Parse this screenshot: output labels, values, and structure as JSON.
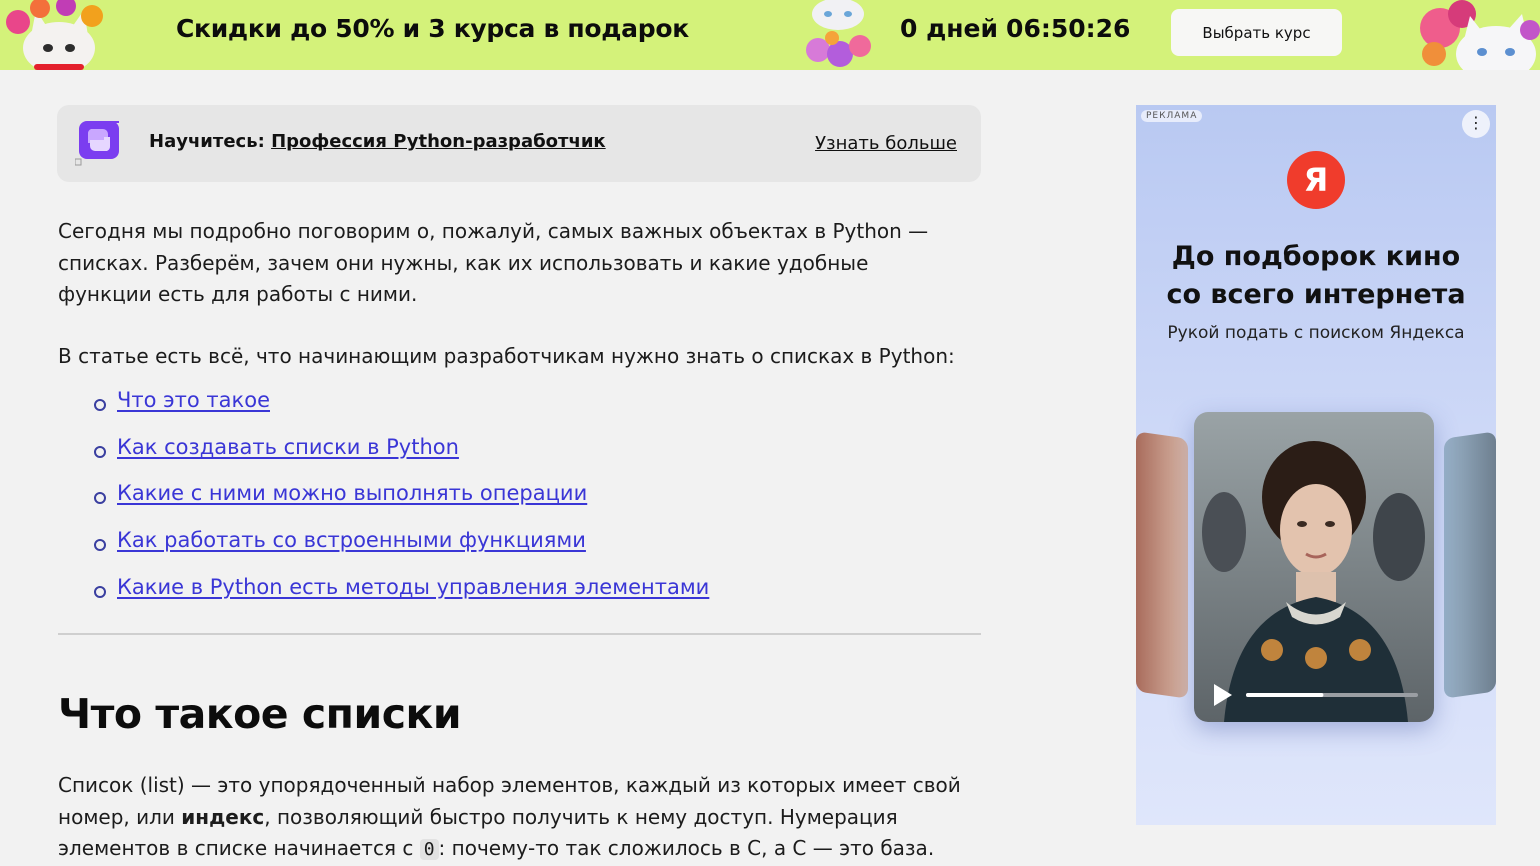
{
  "banner": {
    "title": "Скидки до 50% и 3 курса в подарок",
    "timer_days": "0 дней",
    "timer_time": "06:50:26",
    "button": "Выбрать курс",
    "bg_color": "#d4f27a"
  },
  "learn": {
    "prefix": "Научитесь: ",
    "link": "Профессия Python-разработчик",
    "more": "Узнать больше",
    "icon": "python-course-icon"
  },
  "article": {
    "intro": "Сегодня мы подробно поговорим о, пожалуй, самых важных объектах в Python — списках. Разберём, зачем они нужны, как их использовать и какие удобные функции есть для работы с ними.",
    "toc_intro": "В статье есть всё, что начинающим разработчикам нужно знать о списках в Python:",
    "toc": [
      "Что это такое",
      "Как создавать списки в Python",
      "Какие с ними можно выполнять операции",
      "Как работать со встроенными функциями",
      "Какие в Python есть методы управления элементами"
    ],
    "heading": "Что такое списки",
    "def_part1": "Список (list) — это упорядоченный набор элементов, каждый из которых имеет свой номер, или ",
    "def_bold": "индекс",
    "def_part2": ", позволяющий быстро получить к нему доступ. Нумерация элементов в списке начинается с ",
    "def_code": "0",
    "def_part3": ": почему-то так сложилось в C, а C — это база.",
    "link_color": "#3a36d6"
  },
  "ad": {
    "label": "РЕКЛАМА",
    "menu": "⋮",
    "logo": "Я",
    "headline_line1": "До подборок кино",
    "headline_line2": "со всего интернета",
    "subline": "Рукой подать с поиском Яндекса",
    "video_progress": 0.45,
    "logo_color": "#f03c2c"
  }
}
